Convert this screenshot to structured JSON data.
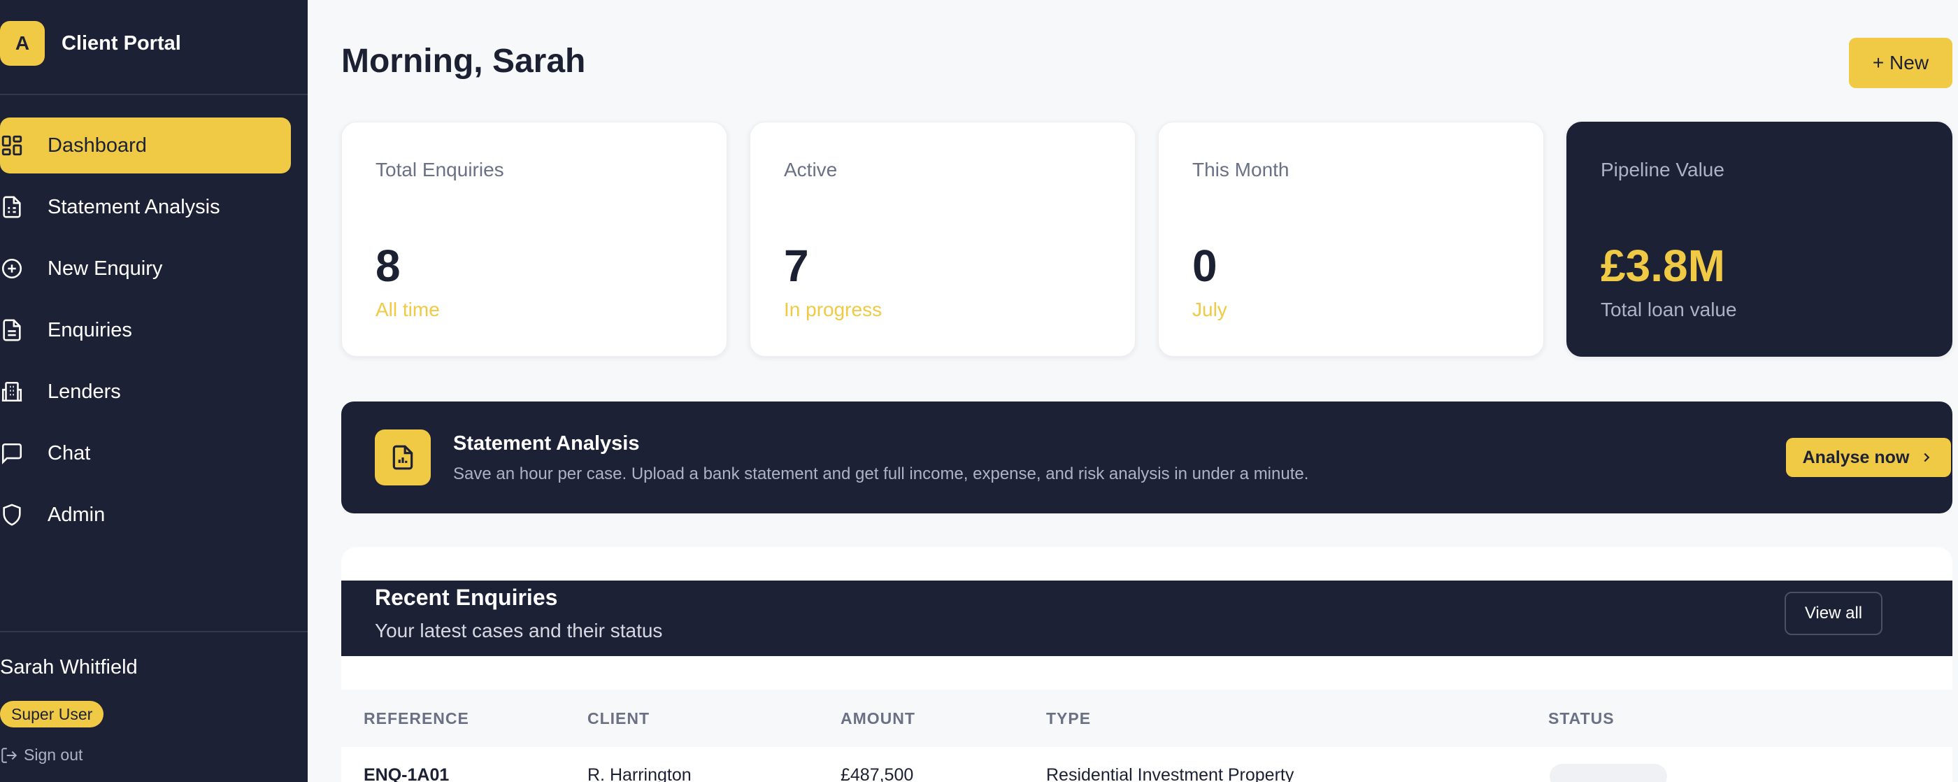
{
  "brand": {
    "logo_letter": "A",
    "title": "Client Portal"
  },
  "nav": {
    "items": [
      {
        "label": "Dashboard",
        "icon": "dashboard-grid-icon",
        "active": true
      },
      {
        "label": "Statement Analysis",
        "icon": "document-list-icon"
      },
      {
        "label": "New Enquiry",
        "icon": "plus-circle-icon"
      },
      {
        "label": "Enquiries",
        "icon": "document-icon"
      },
      {
        "label": "Lenders",
        "icon": "building-icon"
      },
      {
        "label": "Chat",
        "icon": "chat-bubble-icon"
      },
      {
        "label": "Admin",
        "icon": "shield-icon"
      }
    ]
  },
  "user": {
    "name": "Sarah Whitfield",
    "role": "Super User",
    "signout_label": "Sign out"
  },
  "header": {
    "greeting": "Morning, Sarah",
    "new_button": "+ New"
  },
  "stats": [
    {
      "label": "Total Enquiries",
      "value": "8",
      "sub": "All time"
    },
    {
      "label": "Active",
      "value": "7",
      "sub": "In progress"
    },
    {
      "label": "This Month",
      "value": "0",
      "sub": "July"
    },
    {
      "label": "Pipeline Value",
      "value": "£3.8M",
      "sub": "Total loan value"
    }
  ],
  "banner": {
    "title": "Statement Analysis",
    "description": "Save an hour per case. Upload a bank statement and get full income, expense, and risk analysis in under a minute.",
    "button": "Analyse now"
  },
  "recent": {
    "title": "Recent Enquiries",
    "subtitle": "Your latest cases and their status",
    "view_all": "View all",
    "columns": [
      "REFERENCE",
      "CLIENT",
      "AMOUNT",
      "TYPE",
      "STATUS"
    ],
    "rows": [
      {
        "reference": "ENQ-1A01",
        "client": "R. Harrington",
        "amount": "£487,500",
        "type": "Residential Investment Property"
      }
    ]
  },
  "colors": {
    "accent": "#f0c945",
    "navy": "#1d2136",
    "muted": "#6b7185"
  }
}
